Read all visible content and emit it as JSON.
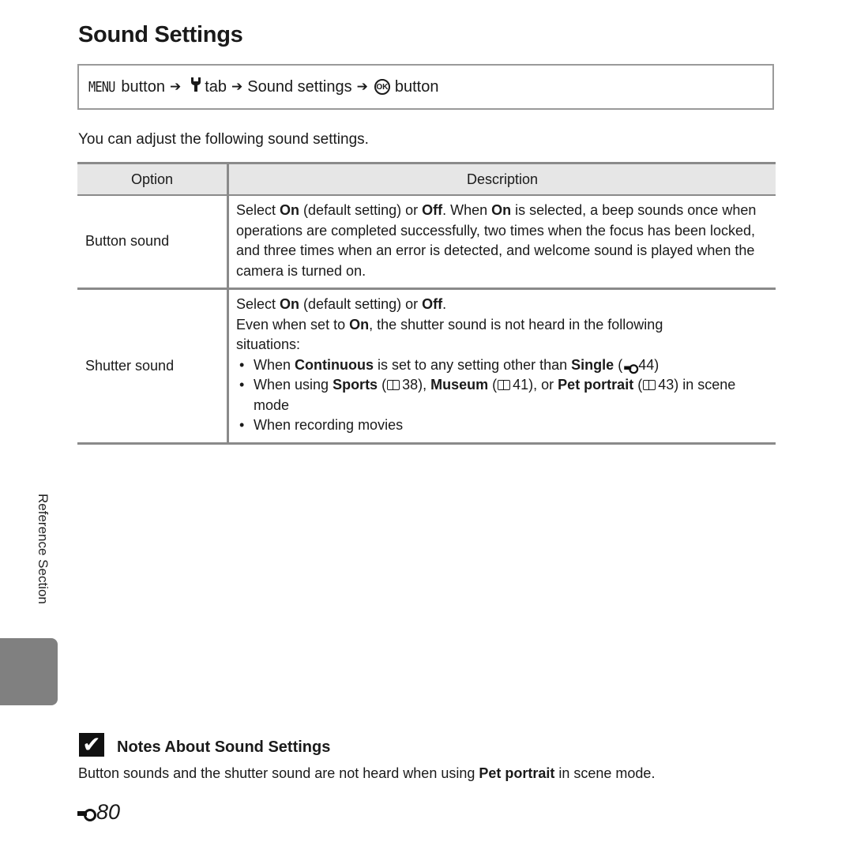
{
  "page": {
    "title": "Sound Settings",
    "navigation": {
      "menu_key": "MENU",
      "step1": "button",
      "arrow": "➔",
      "tab_icon": "wrench-icon",
      "step2": "tab",
      "step3": "Sound settings",
      "ok_key": "OK",
      "step4": "button"
    },
    "intro": "You can adjust the following sound settings.",
    "table": {
      "headers": [
        "Option",
        "Description"
      ],
      "rows": [
        {
          "option": "Button sound",
          "desc": {
            "p1": "Select ",
            "b1": "On",
            "p2": " (default setting) or ",
            "b2": "Off",
            "p3": ". When ",
            "b3": "On",
            "p4": " is selected, a beep sounds once when operations are completed successfully, two times when the focus has been locked, and three times when an error is detected, and welcome sound is played when the camera is turned on."
          }
        },
        {
          "option": "Shutter sound",
          "desc": {
            "l1_p1": "Select ",
            "l1_b1": "On",
            "l1_p2": " (default setting) or ",
            "l1_b2": "Off",
            "l1_p3": ".",
            "l2_p1": "Even when set to ",
            "l2_b1": "On",
            "l2_p2": ", the shutter sound is not heard in the following situations:",
            "bullets": {
              "b1_p1": "When ",
              "b1_b1": "Continuous",
              "b1_p2": " is set to any setting other than ",
              "b1_b2": "Single",
              "b1_p3": " (",
              "b1_ref": "44",
              "b1_p4": ")",
              "b2_p1": "When using ",
              "b2_b1": "Sports",
              "b2_p2": " (",
              "b2_ref1": "38",
              "b2_p3": "), ",
              "b2_b2": "Museum",
              "b2_p4": " (",
              "b2_ref2": "41",
              "b2_p5": "), or ",
              "b2_b3": "Pet portrait",
              "b2_p6": " (",
              "b2_ref3": "43",
              "b2_p7": ") in scene mode",
              "b3": "When recording movies"
            }
          }
        }
      ]
    },
    "side_label": "Reference Section",
    "note": {
      "icon": "check-icon",
      "title": "Notes About Sound Settings",
      "p1": "Button sounds and the shutter sound are not heard when using ",
      "b1": "Pet portrait",
      "p2": " in scene mode."
    },
    "page_number": "80",
    "colors": {
      "border": "#8a8a8a",
      "header_bg": "#e6e6e6",
      "side_tab": "#808080"
    }
  }
}
